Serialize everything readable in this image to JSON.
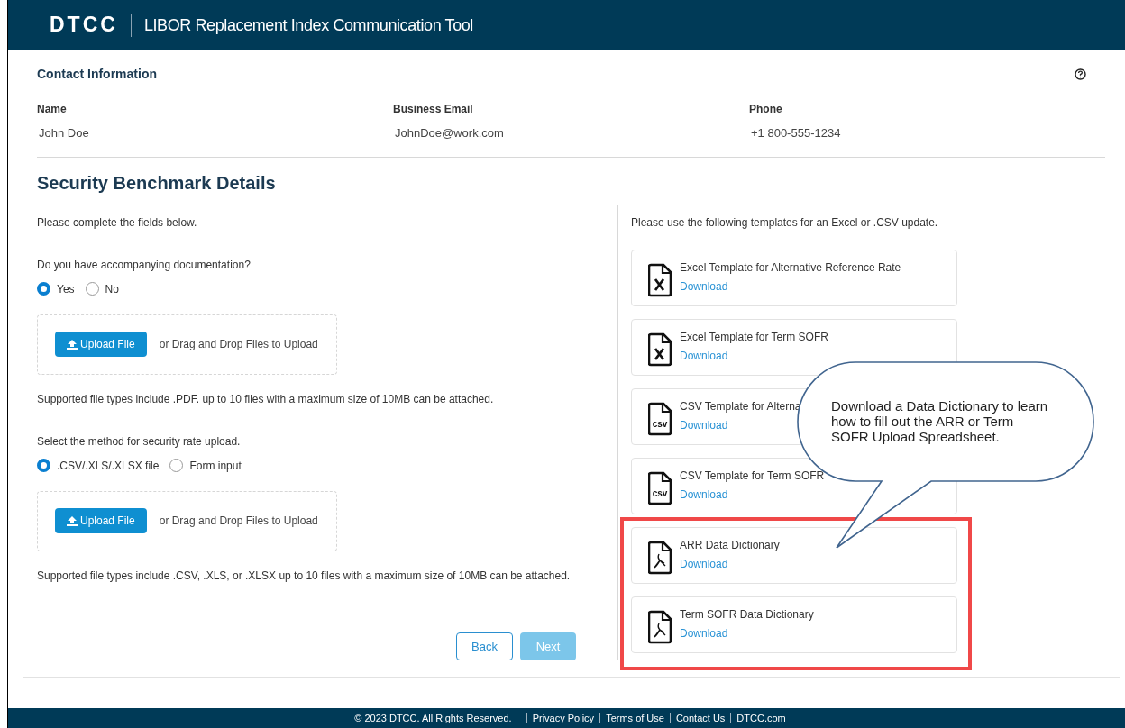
{
  "header": {
    "logo": "DTCC",
    "title": "LIBOR Replacement Index Communication Tool"
  },
  "contact": {
    "heading": "Contact Information",
    "fields": [
      {
        "label": "Name",
        "value": "John Doe"
      },
      {
        "label": "Business Email",
        "value": "JohnDoe@work.com"
      },
      {
        "label": "Phone",
        "value": "+1 800-555-1234"
      }
    ]
  },
  "section_title": "Security Benchmark Details",
  "left": {
    "instruction": "Please complete the fields below.",
    "questions": [
      {
        "question": "Do you have accompanying documentation?",
        "options": [
          {
            "label": "Yes",
            "selected": true
          },
          {
            "label": "No",
            "selected": false
          }
        ],
        "upload": {
          "button": "Upload File",
          "hint": "or Drag and Drop Files to Upload"
        },
        "note": "Supported file types include .PDF. up to 10 files with a maximum size of 10MB can be attached."
      },
      {
        "question": "Select the method for security rate upload.",
        "options": [
          {
            "label": ".CSV/.XLS/.XLSX file",
            "selected": true
          },
          {
            "label": "Form input",
            "selected": false
          }
        ],
        "upload": {
          "button": "Upload File",
          "hint": "or Drag and Drop Files to Upload"
        },
        "note": "Supported file types include .CSV, .XLS, or .XLSX up to 10 files with a maximum size of 10MB can be attached."
      }
    ]
  },
  "right": {
    "instruction": "Please use the following templates for an Excel or .CSV update.",
    "templates": [
      {
        "kind": "excel",
        "title": "Excel Template for Alternative Reference Rate",
        "link": "Download"
      },
      {
        "kind": "excel",
        "title": "Excel Template for Term SOFR",
        "link": "Download"
      },
      {
        "kind": "csv",
        "icon_label": "csv",
        "title": "CSV Template for Alterna",
        "link": "Download"
      },
      {
        "kind": "csv",
        "icon_label": "csv",
        "title": "CSV Template for Term SOFR",
        "link": "Download"
      },
      {
        "kind": "pdf",
        "title": "ARR Data Dictionary",
        "link": "Download"
      },
      {
        "kind": "pdf",
        "title": "Term SOFR Data Dictionary",
        "link": "Download"
      }
    ]
  },
  "buttons": [
    {
      "label": "Back",
      "disabled": false
    },
    {
      "label": "Next",
      "disabled": true
    }
  ],
  "callout": {
    "text": "Download a Data Dictionary to learn how to fill out the ARR or Term SOFR Upload Spreadsheet."
  },
  "footer": {
    "copyright": "© 2023 DTCC. All Rights Reserved.",
    "links": [
      "Privacy Policy",
      "Terms of Use",
      "Contact Us",
      "DTCC.com"
    ]
  }
}
